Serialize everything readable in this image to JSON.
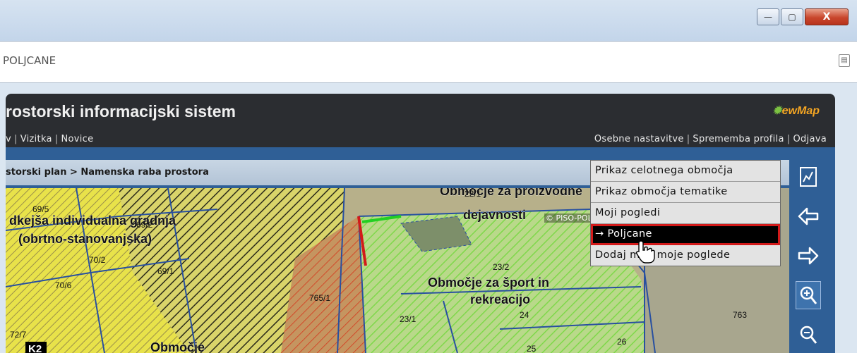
{
  "window": {
    "minimize_label": "—",
    "maximize_label": "▢",
    "close_label": "X"
  },
  "address": {
    "text": "POLJCANE"
  },
  "app": {
    "title": "rostorski informacijski sistem",
    "logo": "ewMap",
    "nav_left": [
      "v",
      "Vizitka",
      "Novice"
    ],
    "nav_right": [
      "Osebne nastavitve",
      "Sprememba profila",
      "Odjava"
    ],
    "breadcrumb": "storski plan > Namenska raba prostora"
  },
  "menu": {
    "items": [
      "Prikaz celotnega območja",
      "Prikaz območja tematike",
      "Moji pogledi",
      "→ Poljcane",
      "Dodaj med moje poglede"
    ],
    "selected_index": 3
  },
  "map": {
    "watermark": "© PISO-POL",
    "labels": {
      "a1": "Območje za proizvodne",
      "a2": "dejavnosti",
      "b1": "dkejša individualna gradnja",
      "b2": "(obrtno-stanovanjska)",
      "c1": "Območje za šport in",
      "c2": "rekreacijo",
      "d": "Območje",
      "k2": "K2"
    },
    "parcels": [
      "69/5",
      "69/2",
      "70/2",
      "69/1",
      "70/6",
      "72/7",
      "765/1",
      "23/2",
      "23/1",
      "24",
      "25",
      "26",
      "763",
      "22/1"
    ]
  },
  "colors": {
    "app_bg": "#2b2d31",
    "toolbar_blue": "#2f5f96",
    "menu_bg": "#e3e3e3",
    "selected_outline": "#d21a1a",
    "zone_yellow": "#e8e24a",
    "zone_green": "#7fd84a",
    "zone_red": "#d24a2a",
    "parcel_line": "#2850a0"
  }
}
